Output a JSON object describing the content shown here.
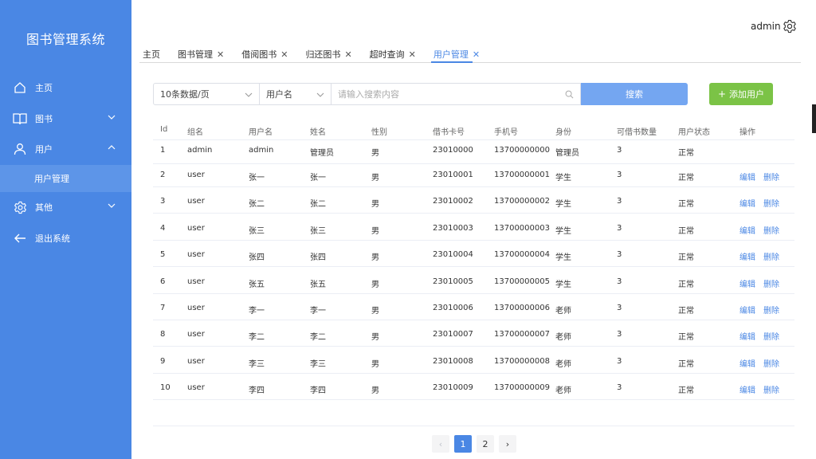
{
  "app": {
    "title": "图书管理系统"
  },
  "header": {
    "user": "admin"
  },
  "sidebar": {
    "items": [
      {
        "label": "主页"
      },
      {
        "label": "图书"
      },
      {
        "label": "用户"
      },
      {
        "label": "其他"
      },
      {
        "label": "退出系统"
      }
    ],
    "sub_item": "用户管理"
  },
  "tabs": [
    {
      "label": "主页",
      "closable": false
    },
    {
      "label": "图书管理",
      "closable": true
    },
    {
      "label": "借阅图书",
      "closable": true
    },
    {
      "label": "归还图书",
      "closable": true
    },
    {
      "label": "超时查询",
      "closable": true
    },
    {
      "label": "用户管理",
      "closable": true,
      "active": true
    }
  ],
  "search": {
    "page_size": "10条数据/页",
    "field": "用户名",
    "placeholder": "请输入搜索内容",
    "search_label": "搜索",
    "add_label": "添加用户"
  },
  "table": {
    "columns": [
      "Id",
      "组名",
      "用户名",
      "姓名",
      "性别",
      "借书卡号",
      "手机号",
      "身份",
      "可借书数量",
      "用户状态",
      "操作"
    ],
    "edit_label": "编辑",
    "delete_label": "删除",
    "rows": [
      [
        "1",
        "admin",
        "admin",
        "管理员",
        "男",
        "23010000",
        "13700000000",
        "管理员",
        "3",
        "正常"
      ],
      [
        "2",
        "user",
        "张一",
        "张一",
        "男",
        "23010001",
        "13700000001",
        "学生",
        "3",
        "正常"
      ],
      [
        "3",
        "user",
        "张二",
        "张二",
        "男",
        "23010002",
        "13700000002",
        "学生",
        "3",
        "正常"
      ],
      [
        "4",
        "user",
        "张三",
        "张三",
        "男",
        "23010003",
        "13700000003",
        "学生",
        "3",
        "正常"
      ],
      [
        "5",
        "user",
        "张四",
        "张四",
        "男",
        "23010004",
        "13700000004",
        "学生",
        "3",
        "正常"
      ],
      [
        "6",
        "user",
        "张五",
        "张五",
        "男",
        "23010005",
        "13700000005",
        "学生",
        "3",
        "正常"
      ],
      [
        "7",
        "user",
        "李一",
        "李一",
        "男",
        "23010006",
        "13700000006",
        "老师",
        "3",
        "正常"
      ],
      [
        "8",
        "user",
        "李二",
        "李二",
        "男",
        "23010007",
        "13700000007",
        "老师",
        "3",
        "正常"
      ],
      [
        "9",
        "user",
        "李三",
        "李三",
        "男",
        "23010008",
        "13700000008",
        "老师",
        "3",
        "正常"
      ],
      [
        "10",
        "user",
        "李四",
        "李四",
        "男",
        "23010009",
        "13700000009",
        "老师",
        "3",
        "正常"
      ]
    ]
  },
  "pagination": {
    "pages": [
      "1",
      "2"
    ],
    "current": "1",
    "prev": "‹",
    "next": "›"
  }
}
